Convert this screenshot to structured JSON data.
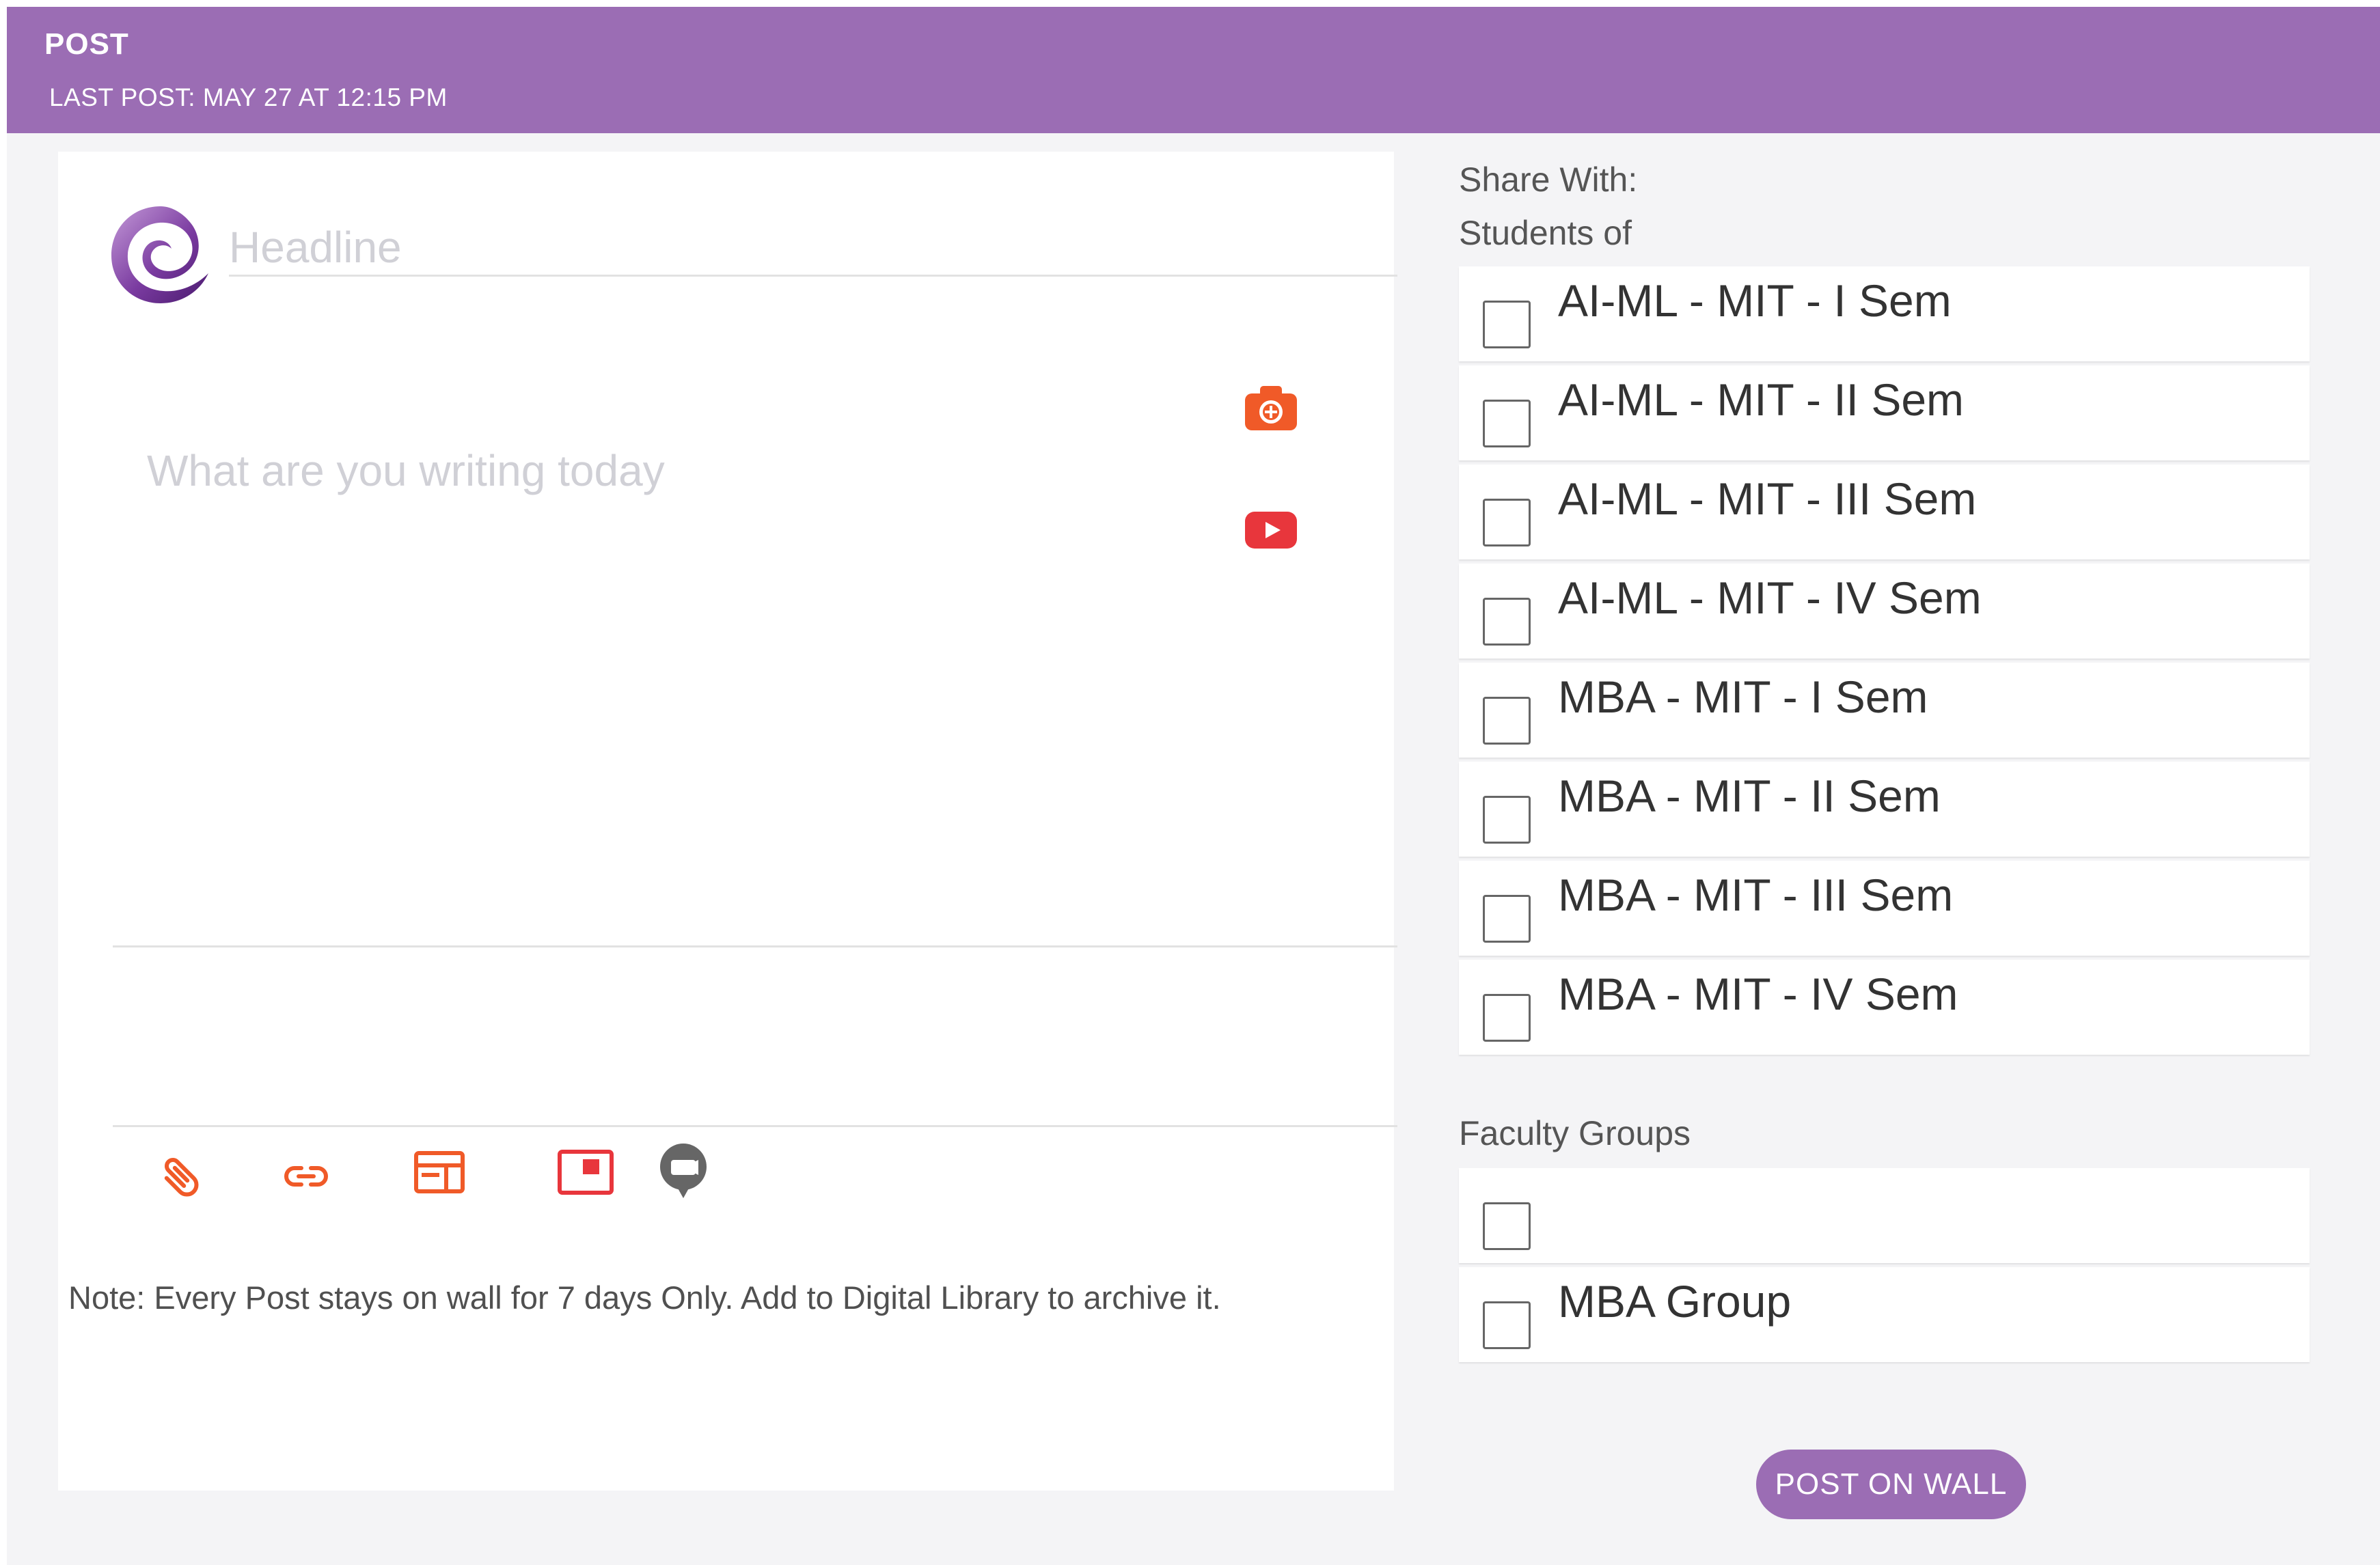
{
  "header": {
    "title": "POST",
    "last_post": "LAST POST: MAY 27 AT 12:15 PM"
  },
  "composer": {
    "headline_placeholder": "Headline",
    "body_placeholder": "What are you writing today",
    "media_icons": [
      "camera-icon",
      "youtube-icon"
    ],
    "toolbar_icons": [
      "paperclip-icon",
      "link-icon",
      "layout-icon",
      "slideshow-icon",
      "chat-bubble-icon"
    ],
    "note": "Note: Every Post stays on wall for 7 days Only. Add to Digital Library to archive it."
  },
  "share": {
    "share_with_label": "Share With:",
    "students_label": "Students of",
    "students": [
      {
        "label": "AI-ML - MIT - I Sem",
        "checked": false
      },
      {
        "label": "AI-ML - MIT - II Sem",
        "checked": false
      },
      {
        "label": "AI-ML - MIT - III Sem",
        "checked": false
      },
      {
        "label": "AI-ML - MIT - IV Sem",
        "checked": false
      },
      {
        "label": "MBA - MIT - I Sem",
        "checked": false
      },
      {
        "label": "MBA - MIT - II Sem",
        "checked": false
      },
      {
        "label": "MBA - MIT - III Sem",
        "checked": false
      },
      {
        "label": "MBA - MIT - IV Sem",
        "checked": false
      }
    ],
    "faculty_label": "Faculty Groups",
    "faculty": [
      {
        "label": "",
        "checked": false
      },
      {
        "label": "MBA Group",
        "checked": false
      }
    ]
  },
  "post_button": "POST ON WALL",
  "colors": {
    "brand_purple": "#9b6db4",
    "icon_orange": "#f05a28",
    "icon_red": "#e8363c",
    "icon_gray": "#666666"
  }
}
